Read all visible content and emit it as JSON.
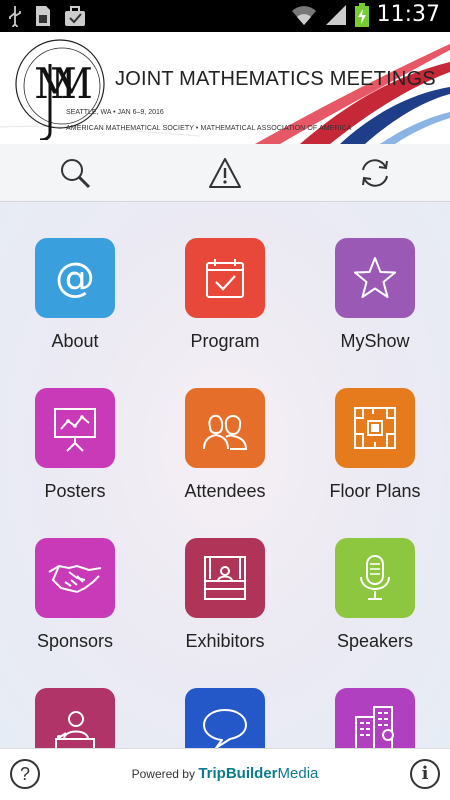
{
  "status_bar": {
    "time": "11:37"
  },
  "banner": {
    "logo_text": "JMM",
    "title": "JOINT MATHEMATICS MEETINGS",
    "location": "SEATTLE, WA • JAN 6–9, 2016",
    "sponsors": "AMERICAN MATHEMATICAL SOCIETY • MATHEMATICAL ASSOCIATION OF AMERICA"
  },
  "toolbar": {
    "search": "search-icon",
    "alert": "alert-icon",
    "sync": "sync-icon"
  },
  "tiles": [
    {
      "label": "About",
      "color": "#3a9fdd",
      "icon": "at-icon"
    },
    {
      "label": "Program",
      "color": "#e8483a",
      "icon": "calendar-check-icon"
    },
    {
      "label": "MyShow",
      "color": "#9b59b6",
      "icon": "star-icon"
    },
    {
      "label": "Posters",
      "color": "#c83ab8",
      "icon": "presentation-icon"
    },
    {
      "label": "Attendees",
      "color": "#e56f2a",
      "icon": "people-icon"
    },
    {
      "label": "Floor Plans",
      "color": "#e57b1c",
      "icon": "floor-plan-icon"
    },
    {
      "label": "Sponsors",
      "color": "#c83ab8",
      "icon": "handshake-icon"
    },
    {
      "label": "Exhibitors",
      "color": "#b03458",
      "icon": "booth-icon"
    },
    {
      "label": "Speakers",
      "color": "#8dc63f",
      "icon": "microphone-icon"
    },
    {
      "label": "",
      "color": "#b03468",
      "icon": "speaker-podium-icon"
    },
    {
      "label": "",
      "color": "#2458c8",
      "icon": "chat-bubble-icon"
    },
    {
      "label": "",
      "color": "#b040c0",
      "icon": "buildings-icon"
    }
  ],
  "footer": {
    "powered_by": "Powered by",
    "brand_bold": "TripBuilder",
    "brand_light": "Media",
    "help": "?",
    "info": "i"
  }
}
